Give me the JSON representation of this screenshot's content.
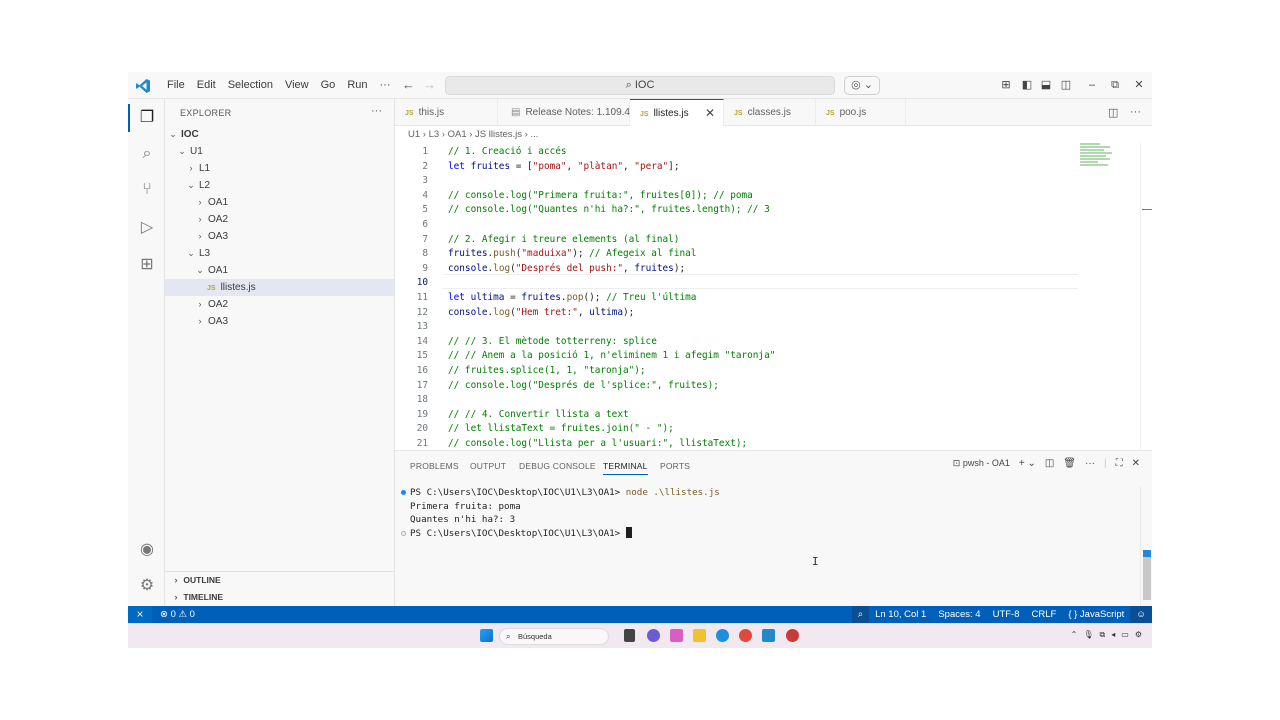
{
  "menu": [
    "File",
    "Edit",
    "Selection",
    "View",
    "Go",
    "Run",
    "···"
  ],
  "search": {
    "label": "IOC"
  },
  "sidebar": {
    "title": "EXPLORER",
    "tree": [
      {
        "label": "IOC",
        "depth": 0,
        "chev": "⌄",
        "bold": true
      },
      {
        "label": "U1",
        "depth": 1,
        "chev": "⌄"
      },
      {
        "label": "L1",
        "depth": 2,
        "chev": "›"
      },
      {
        "label": "L2",
        "depth": 2,
        "chev": "⌄"
      },
      {
        "label": "OA1",
        "depth": 3,
        "chev": "›"
      },
      {
        "label": "OA2",
        "depth": 3,
        "chev": "›"
      },
      {
        "label": "OA3",
        "depth": 3,
        "chev": "›"
      },
      {
        "label": "L3",
        "depth": 2,
        "chev": "⌄"
      },
      {
        "label": "OA1",
        "depth": 3,
        "chev": "⌄"
      },
      {
        "label": "llistes.js",
        "depth": 4,
        "file": true,
        "selected": true
      },
      {
        "label": "OA2",
        "depth": 3,
        "chev": "›"
      },
      {
        "label": "OA3",
        "depth": 3,
        "chev": "›"
      }
    ],
    "outline": "OUTLINE",
    "timeline": "TIMELINE"
  },
  "tabs": [
    {
      "label": "this.js",
      "js": true,
      "active": false
    },
    {
      "label": "Release Notes: 1.109.4",
      "js": false,
      "active": false
    },
    {
      "label": "llistes.js",
      "js": true,
      "active": true
    },
    {
      "label": "classes.js",
      "js": true,
      "active": false
    },
    {
      "label": "poo.js",
      "js": true,
      "active": false
    }
  ],
  "breadcrumb": "U1 › L3 › OA1 › JS llistes.js › ...",
  "editor": {
    "current_line": 10,
    "lines": [
      [
        [
          "cm",
          "// 1. Creació i accés"
        ]
      ],
      [
        [
          "kw",
          "let "
        ],
        [
          "va",
          "fruites"
        ],
        [
          "",
          " = ["
        ],
        [
          "str",
          "\"poma\""
        ],
        [
          "",
          ", "
        ],
        [
          "str",
          "\"plàtan\""
        ],
        [
          "",
          ", "
        ],
        [
          "str",
          "\"pera\""
        ],
        [
          "",
          "];"
        ]
      ],
      [],
      [
        [
          "cm",
          "// console.log(\"Primera fruita:\", fruites[0]); // poma"
        ]
      ],
      [
        [
          "cm",
          "// console.log(\"Quantes n'hi ha?:\", fruites.length); // 3"
        ]
      ],
      [],
      [
        [
          "cm",
          "// 2. Afegir i treure elements (al final)"
        ]
      ],
      [
        [
          "va",
          "fruites"
        ],
        [
          "",
          "."
        ],
        [
          "fn",
          "push"
        ],
        [
          "",
          "("
        ],
        [
          "str",
          "\"maduixa\""
        ],
        [
          "",
          "); "
        ],
        [
          "cm",
          "// Afegeix al final"
        ]
      ],
      [
        [
          "va",
          "console"
        ],
        [
          "",
          "."
        ],
        [
          "fn",
          "log"
        ],
        [
          "",
          "("
        ],
        [
          "str",
          "\"Després del push:\""
        ],
        [
          "",
          ", "
        ],
        [
          "va",
          "fruites"
        ],
        [
          "",
          ");"
        ]
      ],
      [],
      [
        [
          "kw",
          "let "
        ],
        [
          "va",
          "ultima"
        ],
        [
          "",
          " = "
        ],
        [
          "va",
          "fruites"
        ],
        [
          "",
          "."
        ],
        [
          "fn",
          "pop"
        ],
        [
          "",
          "(); "
        ],
        [
          "cm",
          "// Treu l'última"
        ]
      ],
      [
        [
          "va",
          "console"
        ],
        [
          "",
          "."
        ],
        [
          "fn",
          "log"
        ],
        [
          "",
          "("
        ],
        [
          "str",
          "\"Hem tret:\""
        ],
        [
          "",
          ", "
        ],
        [
          "va",
          "ultima"
        ],
        [
          "",
          ");"
        ]
      ],
      [],
      [
        [
          "cm",
          "// // 3. El mètode totterreny: splice"
        ]
      ],
      [
        [
          "cm",
          "// // Anem a la posició 1, n'eliminem 1 i afegim \"taronja\""
        ]
      ],
      [
        [
          "cm",
          "// fruites.splice(1, 1, \"taronja\");"
        ]
      ],
      [
        [
          "cm",
          "// console.log(\"Després de l'splice:\", fruites);"
        ]
      ],
      [],
      [
        [
          "cm",
          "// // 4. Convertir llista a text"
        ]
      ],
      [
        [
          "cm",
          "// let llistaText = fruites.join(\" - \");"
        ]
      ],
      [
        [
          "cm",
          "// console.log(\"Llista per a l'usuari:\", llistaText);"
        ]
      ]
    ]
  },
  "panel": {
    "tabs": [
      "PROBLEMS",
      "OUTPUT",
      "DEBUG CONSOLE",
      "TERMINAL",
      "PORTS"
    ],
    "active_tab": "TERMINAL",
    "shell": "pwsh - OA1",
    "terminal": {
      "prompt1": "PS C:\\Users\\IOC\\Desktop\\IOC\\U1\\L3\\OA1> ",
      "command": "node .\\llistes.js",
      "out1": "Primera fruita: poma",
      "out2": "Quantes n'hi ha?: 3",
      "prompt2": "PS C:\\Users\\IOC\\Desktop\\IOC\\U1\\L3\\OA1> "
    }
  },
  "status": {
    "problems": "⊗ 0 ⚠ 0",
    "position": "Ln 10, Col 1",
    "spaces": "Spaces: 4",
    "encoding": "UTF-8",
    "eol": "CRLF",
    "language": "{ } JavaScript"
  },
  "taskbar": {
    "search": "Búsqueda"
  },
  "colors": {
    "accent": "#005fb8",
    "comment": "#008000",
    "keyword": "#0000ff",
    "string": "#a31515"
  }
}
